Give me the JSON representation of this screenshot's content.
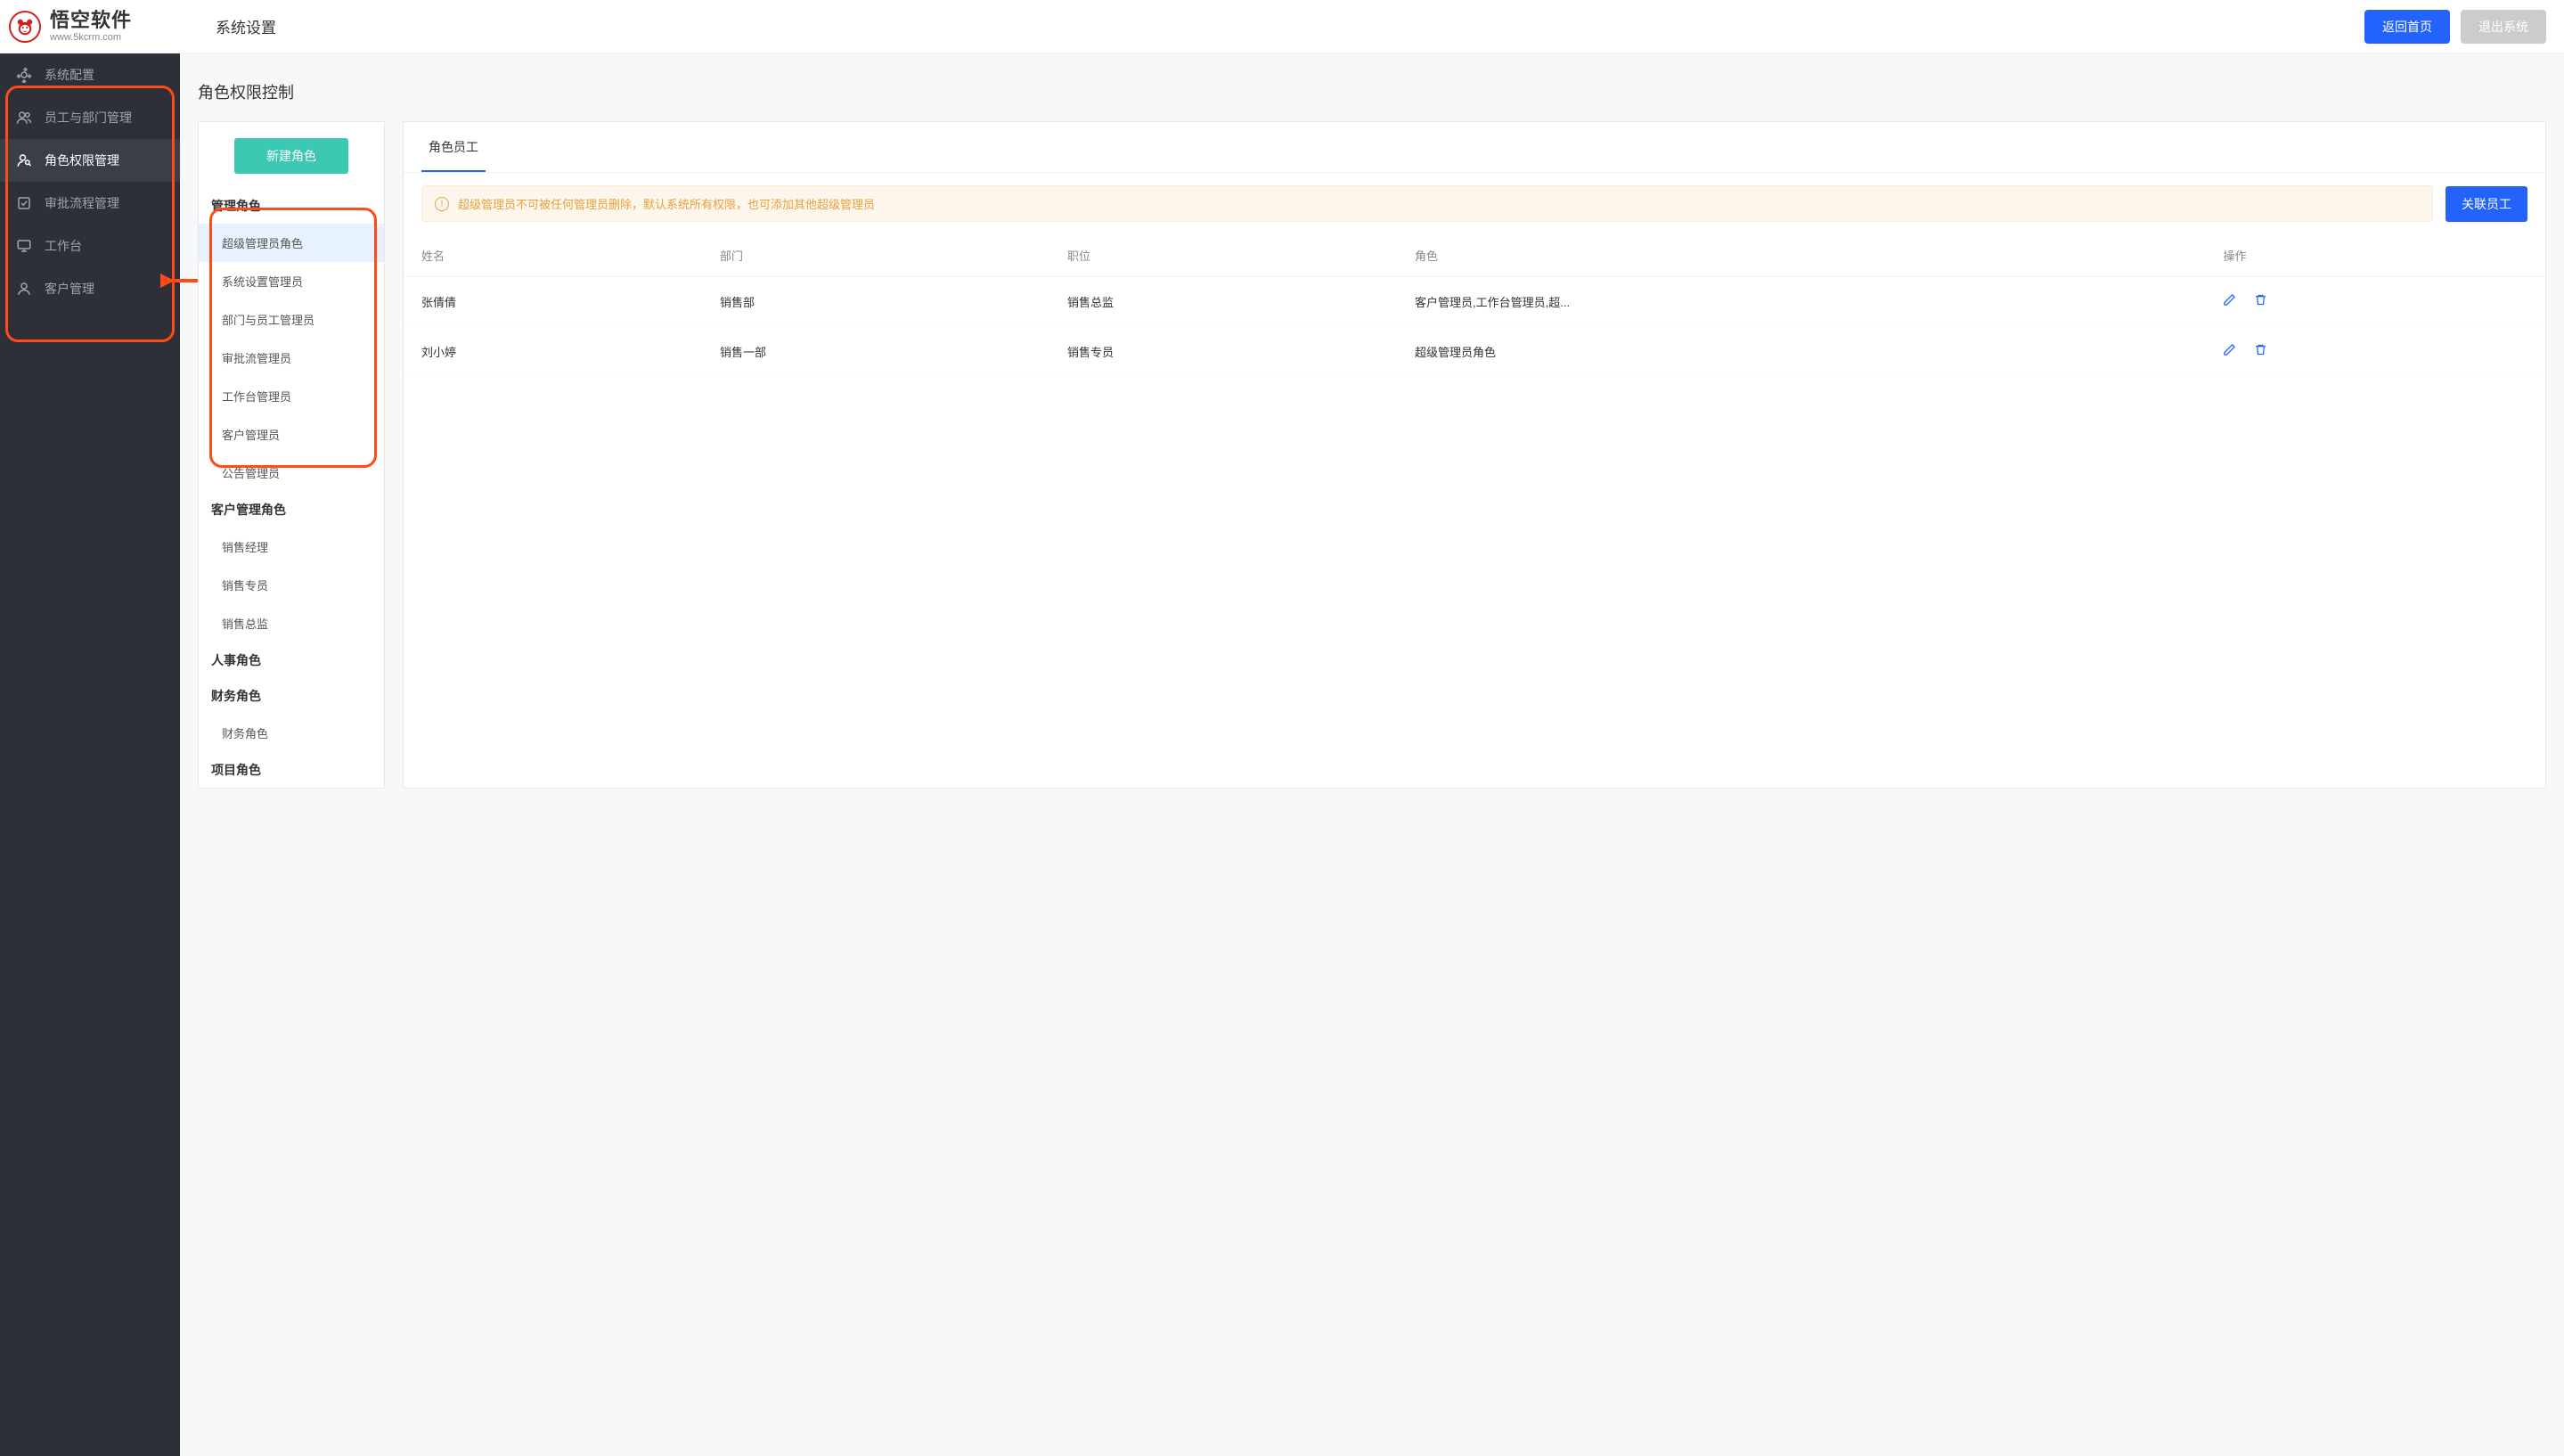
{
  "header": {
    "logo_cn": "悟空软件",
    "logo_en": "www.5kcrm.com",
    "title": "系统设置",
    "back_home": "返回首页",
    "logout": "退出系统"
  },
  "sidebar": {
    "items": [
      {
        "label": "系统配置",
        "icon": "gear"
      },
      {
        "label": "员工与部门管理",
        "icon": "users"
      },
      {
        "label": "角色权限管理",
        "icon": "user-key",
        "active": true
      },
      {
        "label": "审批流程管理",
        "icon": "approval"
      },
      {
        "label": "工作台",
        "icon": "desktop"
      },
      {
        "label": "客户管理",
        "icon": "user"
      }
    ]
  },
  "page": {
    "title": "角色权限控制",
    "new_role_button": "新建角色",
    "role_groups": [
      {
        "title": "管理角色",
        "roles": [
          {
            "label": "超级管理员角色",
            "active": true
          },
          {
            "label": "系统设置管理员"
          },
          {
            "label": "部门与员工管理员"
          },
          {
            "label": "审批流管理员"
          },
          {
            "label": "工作台管理员"
          },
          {
            "label": "客户管理员"
          },
          {
            "label": "公告管理员"
          }
        ]
      },
      {
        "title": "客户管理角色",
        "roles": [
          {
            "label": "销售经理"
          },
          {
            "label": "销售专员"
          },
          {
            "label": "销售总监"
          }
        ]
      },
      {
        "title": "人事角色",
        "roles": []
      },
      {
        "title": "财务角色",
        "roles": [
          {
            "label": "财务角色"
          }
        ]
      },
      {
        "title": "项目角色",
        "roles": []
      }
    ],
    "tab_label": "角色员工",
    "alert_text": "超级管理员不可被任何管理员删除，默认系统所有权限，也可添加其他超级管理员",
    "assoc_button": "关联员工",
    "columns": {
      "name": "姓名",
      "dept": "部门",
      "position": "职位",
      "role": "角色",
      "op": "操作"
    },
    "rows": [
      {
        "name": "张倩倩",
        "dept": "销售部",
        "position": "销售总监",
        "role": "客户管理员,工作台管理员,超..."
      },
      {
        "name": "刘小婷",
        "dept": "销售一部",
        "position": "销售专员",
        "role": "超级管理员角色"
      }
    ]
  }
}
